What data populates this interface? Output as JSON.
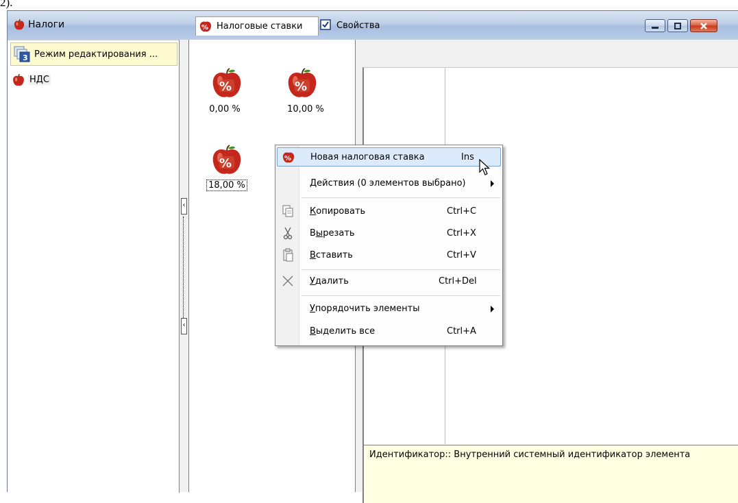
{
  "caption": "2).",
  "window": {
    "title": "Налоги",
    "controls": {
      "minimize": "minimize-icon",
      "maximize": "maximize-icon",
      "close": "close-icon"
    }
  },
  "left_pane": {
    "tab_label": "Режим редактирования ...",
    "tab_badge": "3",
    "tree": [
      {
        "label": "НДС",
        "icon": "apple-icon"
      }
    ]
  },
  "center_pane": {
    "tabs": [
      {
        "label": "Налоговые ставки",
        "icon": "percent-apple-icon",
        "active": true
      },
      {
        "label": "Свойства",
        "icon": "checkbox-icon",
        "active": false
      }
    ],
    "rates": [
      {
        "label": "0,00 %"
      },
      {
        "label": "10,00 %"
      },
      {
        "label": "18,00 %",
        "selected": true
      }
    ]
  },
  "info_pane": {
    "text": "Идентификатор:: Внутренний системный идентификатор элемента"
  },
  "context_menu": {
    "items": [
      {
        "label": "Новая налоговая ставка",
        "shortcut": "Ins",
        "icon": "percent-apple-icon",
        "hover": true
      },
      {
        "label": "Действия (0 элементов выбрано)",
        "submenu": true
      },
      {
        "label": "Копировать",
        "shortcut": "Ctrl+C",
        "icon": "copy-icon",
        "underline": "К",
        "rest": "опировать"
      },
      {
        "label": "Вырезать",
        "shortcut": "Ctrl+X",
        "icon": "scissors-icon",
        "pre": "В",
        "underline": "ы",
        "rest": "резать"
      },
      {
        "label": "Вставить",
        "shortcut": "Ctrl+V",
        "icon": "paste-icon",
        "underline": "В",
        "rest": "ставить"
      },
      {
        "label": "Удалить",
        "shortcut": "Ctrl+Del",
        "icon": "delete-x-icon",
        "underline": "У",
        "rest": "далить"
      },
      {
        "label": "Упорядочить элементы",
        "submenu": true,
        "underline": "У",
        "rest": "порядочить элементы"
      },
      {
        "label": "Выделить все",
        "shortcut": "Ctrl+A",
        "underline": "В",
        "rest": "ыделить все"
      }
    ]
  },
  "colors": {
    "titlebar": "#bccfe8",
    "info_background": "#ffffe1",
    "tab_highlight": "#fffbd0",
    "menu_hover": "#dcebfc",
    "apple_red": "#c0281c"
  }
}
